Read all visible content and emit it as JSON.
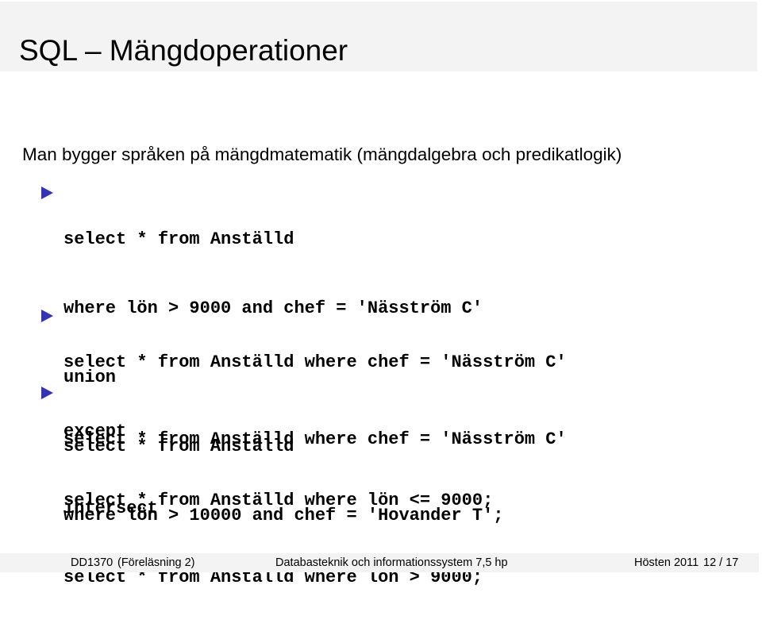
{
  "slide": {
    "title": "SQL – Mängdoperationer",
    "intro": "Man bygger språken på mängdmatematik (mängdalgebra och predikatlogik)",
    "items": [
      {
        "lines": [
          "select * from Anställd",
          "where lön > 9000 and chef = ′Näsström C′",
          "union",
          "select * from Anställd",
          "where lön > 10000 and chef = ′Hovander T′;"
        ]
      },
      {
        "lines": [
          "select * from Anställd where chef = ′Näsström C′",
          "except",
          "select * from Anställd where lön <= 9000;"
        ]
      },
      {
        "lines": [
          "select * from Anställd where chef = ′Näsström C′",
          "intersect",
          "select * from Anställd where lön > 9000;"
        ]
      }
    ],
    "bullet_color": "#3333b3"
  },
  "footer": {
    "course": "DD1370",
    "lecture": "(Föreläsning 2)",
    "course_name": "Databasteknik och informationssystem 7,5 hp",
    "term": "Hösten 2011",
    "page": "12 / 17"
  }
}
